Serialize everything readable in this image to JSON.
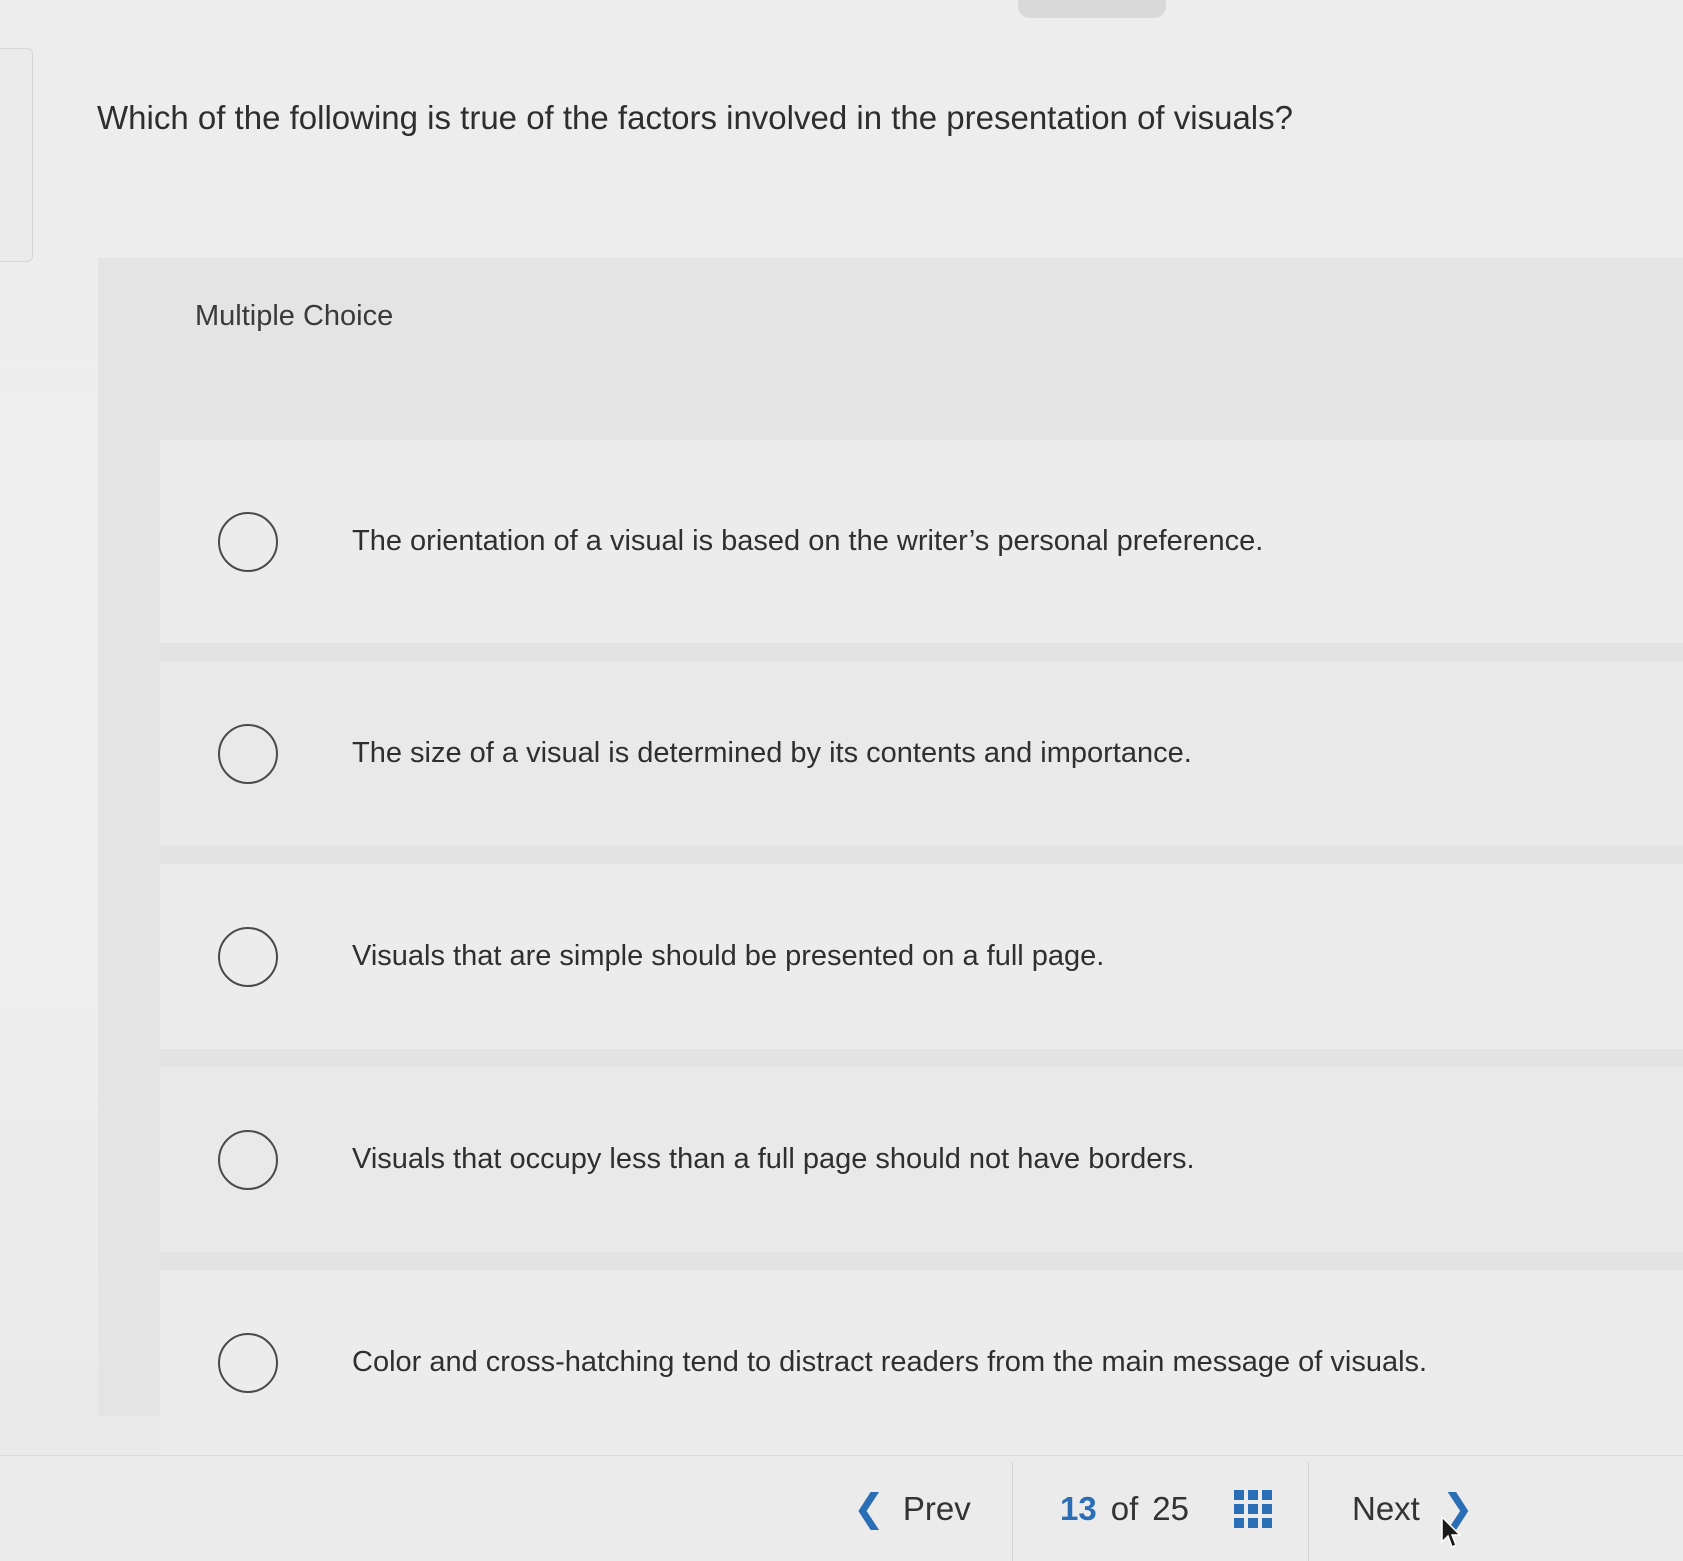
{
  "question": {
    "text": "Which of the following is true of the factors involved in the presentation of visuals?"
  },
  "question_type": {
    "label": "Multiple Choice"
  },
  "options": [
    {
      "text": "The orientation of a visual is based on the writer’s personal preference.",
      "selected": false
    },
    {
      "text": "The size of a visual is determined by its contents and importance.",
      "selected": false
    },
    {
      "text": "Visuals that are simple should be presented on a full page.",
      "selected": false
    },
    {
      "text": "Visuals that occupy less than a full page should not have borders.",
      "selected": false
    },
    {
      "text": "Color and cross-hatching tend to distract readers from the main message of visuals.",
      "selected": false
    }
  ],
  "navigation": {
    "prev_label": "Prev",
    "next_label": "Next",
    "current": "13",
    "of_label": "of",
    "total": "25",
    "prev_icon": "chevron-left-icon",
    "next_icon": "chevron-right-icon",
    "grid_icon": "question-grid-icon"
  },
  "colors": {
    "accent": "#2a6fb5",
    "text": "#2f2f2f",
    "background": "#ececec"
  }
}
